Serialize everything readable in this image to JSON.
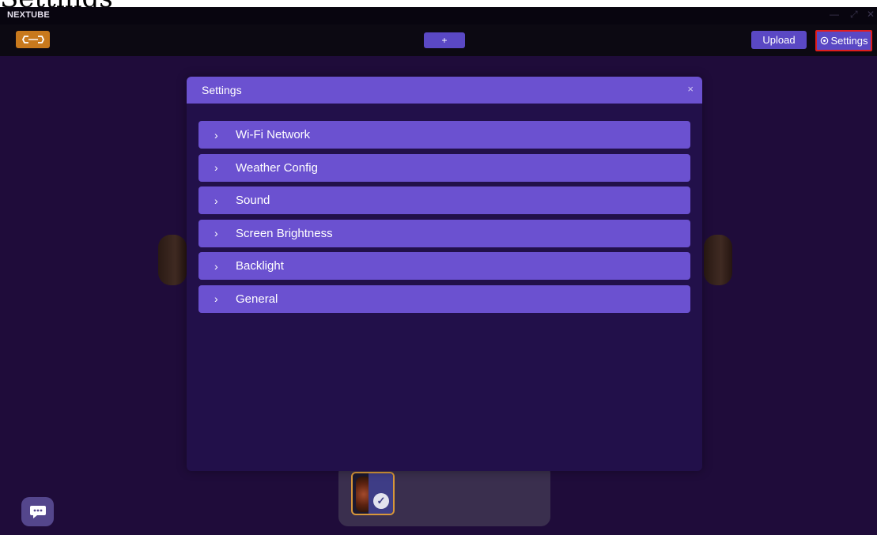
{
  "page": {
    "heading": "Settings"
  },
  "titlebar": {
    "app_name": "NEXTUBE",
    "minimize": "—",
    "restore": "⤢",
    "close": "✕"
  },
  "toolbar": {
    "add_label": "+",
    "upload_label": "Upload",
    "settings_label": "Settings"
  },
  "dialog": {
    "title": "Settings",
    "close_icon": "×",
    "items": [
      {
        "label": "Wi-Fi Network"
      },
      {
        "label": "Weather Config"
      },
      {
        "label": "Sound"
      },
      {
        "label": "Screen Brightness"
      },
      {
        "label": "Backlight"
      },
      {
        "label": "General"
      }
    ]
  },
  "icons": {
    "logo": "nextube-logo-icon",
    "settings": "gear-icon",
    "chevron": "chevron-right-icon",
    "chat": "chat-bubble-icon",
    "check": "check-circle-icon"
  },
  "colors": {
    "accent": "#6b51d0",
    "button": "#5a48c4",
    "logo": "#c8791d",
    "highlight_border": "#e01d1d",
    "dialog_bg": "#22104a",
    "app_bg": "#1f0c3a"
  }
}
